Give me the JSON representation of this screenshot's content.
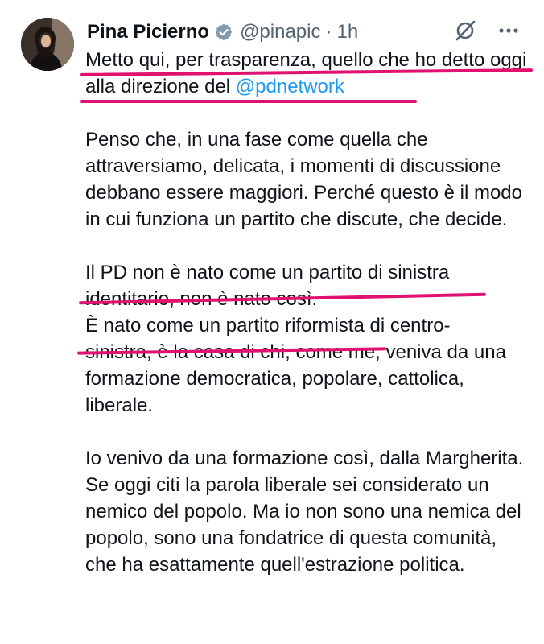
{
  "author": {
    "display_name": "Pina Picierno",
    "handle": "@pinapic",
    "separator": "·",
    "time": "1h"
  },
  "tweet": {
    "intro_text": "Metto qui, per trasparenza, quello che ho detto oggi alla direzione del ",
    "mention": "@pdnetwork",
    "p1": "Penso che, in una fase come quella che attraversiamo, delicata, i momenti di discussione debbano essere maggiori. Perché questo è il modo in cui funziona un partito che discute, che decide.",
    "p2_line1": "Il PD non è nato come un partito di sinistra",
    "p2_line2": "identitario, non è nato così.",
    "p2_line3": "È nato come un partito riformista di centro-",
    "p2_rest": "sinistra, è la casa di chi, come me, veniva da una formazione democratica, popolare, cattolica, liberale.",
    "p3_a": "Io venivo da una formazione così, dalla Margherita.",
    "p3_b": "Se oggi citi la parola liberale sei considerato un nemico del popolo. Ma io non sono una nemica del popolo, sono una fondatrice di questa comunità, che ha esattamente quell'estrazione politica."
  },
  "colors": {
    "highlight_underline": "#e0116f",
    "link": "#1d9bf0",
    "verified_badge": "#829aab",
    "secondary_text": "#536471"
  },
  "icons": {
    "verified": "verified-badge-icon",
    "grok": "grok-icon",
    "more": "more-options-icon"
  }
}
